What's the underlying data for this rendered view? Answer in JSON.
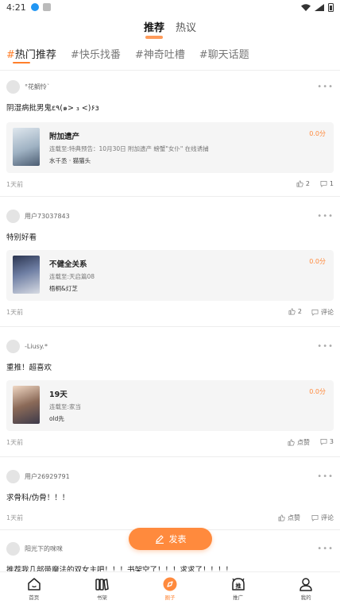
{
  "status_bar": {
    "time": "4:21"
  },
  "top_tabs": [
    {
      "label": "推荐",
      "active": true
    },
    {
      "label": "热议",
      "active": false
    }
  ],
  "topics": [
    {
      "hash": "#",
      "label": "热门推荐",
      "active": true
    },
    {
      "hash": "#",
      "label": "快乐找番",
      "active": false
    },
    {
      "hash": "#",
      "label": "神奇吐槽",
      "active": false
    },
    {
      "hash": "#",
      "label": "聊天话题",
      "active": false
    }
  ],
  "posts": [
    {
      "username": "°花鲷怜ˋ",
      "text": "阴湿病批男鬼ε٩(๑> ₃ <)۶з",
      "book": {
        "title": "附加遗产",
        "subtitle": "连载至:特典预告：10月30日 附加遗产 螃蟹\"女仆\" 在线诱捕",
        "author": "水千丞 · 猫猫头",
        "score": "0.0分"
      },
      "time_ago": "1天前",
      "likes": "2",
      "comments": "1"
    },
    {
      "username": "用户73037843",
      "text": "特别好看",
      "book": {
        "title": "不健全关系",
        "subtitle": "连载至:天启篇08",
        "author": "梧桐&灯芝",
        "score": "0.0分"
      },
      "time_ago": "1天前",
      "likes": "2",
      "comments": "评论"
    },
    {
      "username": "-Liusy.*",
      "text": "重推！超喜欢",
      "book": {
        "title": "19天",
        "subtitle": "连载至:家当",
        "author": "old先",
        "score": "0.0分"
      },
      "time_ago": "1天前",
      "likes": "点赞",
      "comments": "3"
    },
    {
      "username": "用户26929791",
      "text": "求骨科/伪骨！！！",
      "time_ago": "1天前",
      "likes": "点赞",
      "comments": "评论"
    },
    {
      "username": "阳光下的咪咪",
      "text": "推荐我几部带魔法的双女主吧！！！书架空了！！！求求了！！！！"
    }
  ],
  "fab": {
    "label": "发表"
  },
  "bottom_nav": [
    {
      "label": "首页",
      "icon": "home-icon",
      "active": false
    },
    {
      "label": "书架",
      "icon": "bookshelf-icon",
      "active": false
    },
    {
      "label": "圈子",
      "icon": "circle-icon",
      "active": true
    },
    {
      "label": "推广",
      "icon": "promote-icon",
      "active": false
    },
    {
      "label": "我的",
      "icon": "profile-icon",
      "active": false
    }
  ],
  "colors": {
    "accent": "#ff8a3d"
  }
}
